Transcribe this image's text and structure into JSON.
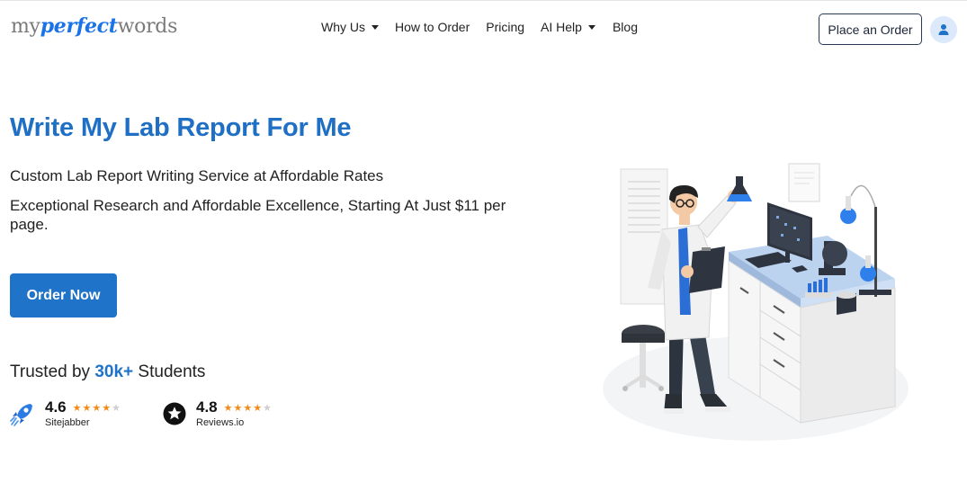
{
  "logo": {
    "part1": "my",
    "part2": "perfect",
    "part3": "words"
  },
  "nav": {
    "why_us": "Why Us",
    "how_to_order": "How to Order",
    "pricing": "Pricing",
    "ai_help": "AI Help",
    "blog": "Blog"
  },
  "header": {
    "order_button": "Place an Order",
    "account_icon": "user-icon"
  },
  "hero": {
    "title": "Write My Lab Report For Me",
    "subtitle": "Custom Lab Report Writing Service at Affordable Rates",
    "description": "Exceptional Research and Affordable Excellence, Starting At Just $11 per page.",
    "cta": "Order Now"
  },
  "trusted": {
    "prefix": "Trusted by",
    "highlight": "30k+",
    "suffix": "Students"
  },
  "ratings": [
    {
      "score": "4.6",
      "site": "Sitejabber",
      "stars": 4,
      "icon": "rocket-icon"
    },
    {
      "score": "4.8",
      "site": "Reviews.io",
      "stars": 4,
      "icon": "star-badge-icon"
    }
  ],
  "colors": {
    "accent": "#1f73c8",
    "title": "#1f6fc4",
    "star": "#f28b1a"
  }
}
